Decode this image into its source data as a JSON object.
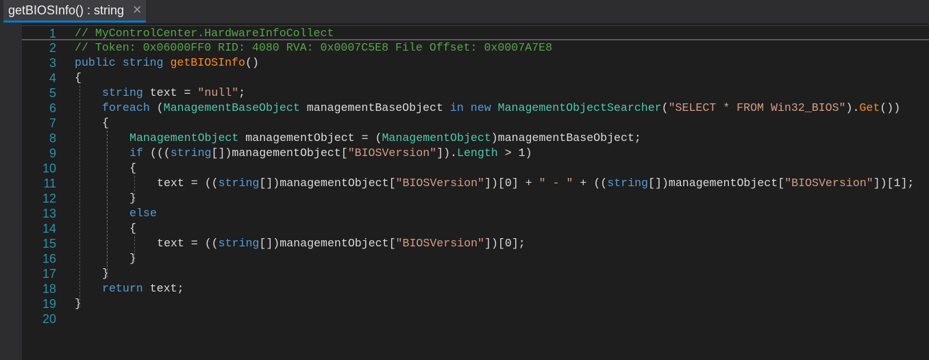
{
  "tab": {
    "title": "getBIOSInfo() : string",
    "close_glyph": "✕"
  },
  "lines": [
    {
      "n": "1",
      "indent": 0,
      "cur": true,
      "tokens": [
        [
          "c",
          "// MyControlCenter.HardwareInfoCollect"
        ]
      ]
    },
    {
      "n": "2",
      "indent": 0,
      "tokens": [
        [
          "c",
          "// Token: 0x06000FF0 RID: 4080 RVA: 0x0007C5E8 File Offset: 0x0007A7E8"
        ]
      ]
    },
    {
      "n": "3",
      "indent": 0,
      "tokens": [
        [
          "k",
          "public"
        ],
        [
          "d",
          " "
        ],
        [
          "k",
          "string"
        ],
        [
          "d",
          " "
        ],
        [
          "m",
          "getBIOSInfo"
        ],
        [
          "d",
          "()"
        ]
      ]
    },
    {
      "n": "4",
      "indent": 0,
      "tokens": [
        [
          "d",
          "{"
        ]
      ]
    },
    {
      "n": "5",
      "indent": 1,
      "tokens": [
        [
          "k",
          "string"
        ],
        [
          "d",
          " text = "
        ],
        [
          "s",
          "\"null\""
        ],
        [
          "d",
          ";"
        ]
      ]
    },
    {
      "n": "6",
      "indent": 1,
      "tokens": [
        [
          "k",
          "foreach"
        ],
        [
          "d",
          " ("
        ],
        [
          "t",
          "ManagementBaseObject"
        ],
        [
          "d",
          " managementBaseObject "
        ],
        [
          "k",
          "in"
        ],
        [
          "d",
          " "
        ],
        [
          "k",
          "new"
        ],
        [
          "d",
          " "
        ],
        [
          "t",
          "ManagementObjectSearcher"
        ],
        [
          "d",
          "("
        ],
        [
          "s",
          "\"SELECT * FROM Win32_BIOS\""
        ],
        [
          "d",
          ")."
        ],
        [
          "m",
          "Get"
        ],
        [
          "d",
          "())"
        ]
      ]
    },
    {
      "n": "7",
      "indent": 1,
      "tokens": [
        [
          "d",
          "{"
        ]
      ]
    },
    {
      "n": "8",
      "indent": 2,
      "tokens": [
        [
          "t",
          "ManagementObject"
        ],
        [
          "d",
          " managementObject = ("
        ],
        [
          "t",
          "ManagementObject"
        ],
        [
          "d",
          ")managementBaseObject;"
        ]
      ]
    },
    {
      "n": "9",
      "indent": 2,
      "tokens": [
        [
          "k",
          "if"
        ],
        [
          "d",
          " ((("
        ],
        [
          "k",
          "string"
        ],
        [
          "d",
          "[])managementObject["
        ],
        [
          "s",
          "\"BIOSVersion\""
        ],
        [
          "d",
          "])."
        ],
        [
          "pr",
          "Length"
        ],
        [
          "d",
          " > 1)"
        ]
      ]
    },
    {
      "n": "10",
      "indent": 2,
      "tokens": [
        [
          "d",
          "{"
        ]
      ]
    },
    {
      "n": "11",
      "indent": 3,
      "tokens": [
        [
          "d",
          "text = (("
        ],
        [
          "k",
          "string"
        ],
        [
          "d",
          "[])managementObject["
        ],
        [
          "s",
          "\"BIOSVersion\""
        ],
        [
          "d",
          "])[0] + "
        ],
        [
          "s",
          "\" - \""
        ],
        [
          "d",
          " + (("
        ],
        [
          "k",
          "string"
        ],
        [
          "d",
          "[])managementObject["
        ],
        [
          "s",
          "\"BIOSVersion\""
        ],
        [
          "d",
          "])[1];"
        ]
      ]
    },
    {
      "n": "12",
      "indent": 2,
      "tokens": [
        [
          "d",
          "}"
        ]
      ]
    },
    {
      "n": "13",
      "indent": 2,
      "tokens": [
        [
          "k",
          "else"
        ]
      ]
    },
    {
      "n": "14",
      "indent": 2,
      "tokens": [
        [
          "d",
          "{"
        ]
      ]
    },
    {
      "n": "15",
      "indent": 3,
      "tokens": [
        [
          "d",
          "text = (("
        ],
        [
          "k",
          "string"
        ],
        [
          "d",
          "[])managementObject["
        ],
        [
          "s",
          "\"BIOSVersion\""
        ],
        [
          "d",
          "])[0];"
        ]
      ]
    },
    {
      "n": "16",
      "indent": 2,
      "tokens": [
        [
          "d",
          "}"
        ]
      ]
    },
    {
      "n": "17",
      "indent": 1,
      "tokens": [
        [
          "d",
          "}"
        ]
      ]
    },
    {
      "n": "18",
      "indent": 1,
      "tokens": [
        [
          "k",
          "return"
        ],
        [
          "d",
          " text;"
        ]
      ]
    },
    {
      "n": "19",
      "indent": 0,
      "tokens": [
        [
          "d",
          "}"
        ]
      ]
    },
    {
      "n": "20",
      "indent": 0,
      "tokens": []
    }
  ]
}
